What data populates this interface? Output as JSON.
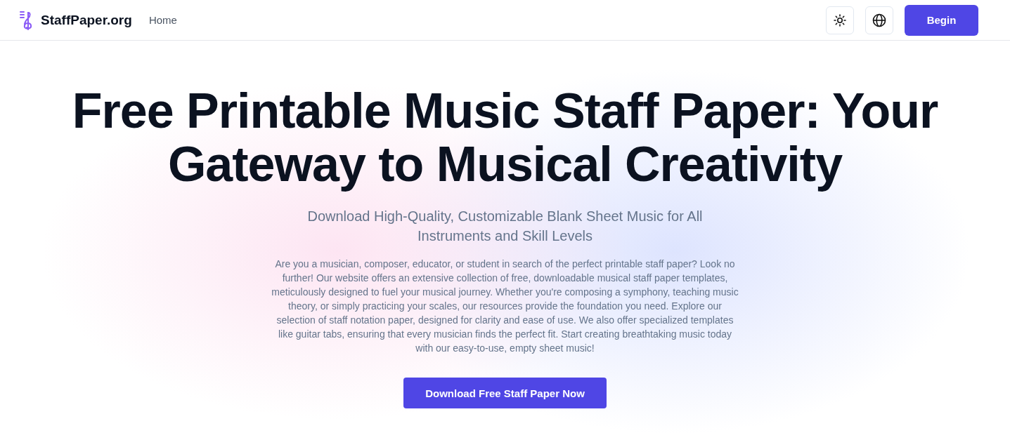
{
  "header": {
    "brand": "StaffPaper.org",
    "nav": [
      {
        "label": "Home"
      }
    ],
    "begin_button": "Begin"
  },
  "hero": {
    "title": "Free Printable Music Staff Paper: Your Gateway to Musical Creativity",
    "subtitle": "Download High-Quality, Customizable Blank Sheet Music for All Instruments and Skill Levels",
    "body": "Are you a musician, composer, educator, or student in search of the perfect printable staff paper? Look no further! Our website offers an extensive collection of free, downloadable musical staff paper templates, meticulously designed to fuel your musical journey. Whether you're composing a symphony, teaching music theory, or simply practicing your scales, our resources provide the foundation you need. Explore our selection of staff notation paper, designed for clarity and ease of use. We also offer specialized templates like guitar tabs, ensuring that every musician finds the perfect fit. Start creating breathtaking music today with our easy-to-use, empty sheet music!",
    "cta": "Download Free Staff Paper Now"
  }
}
